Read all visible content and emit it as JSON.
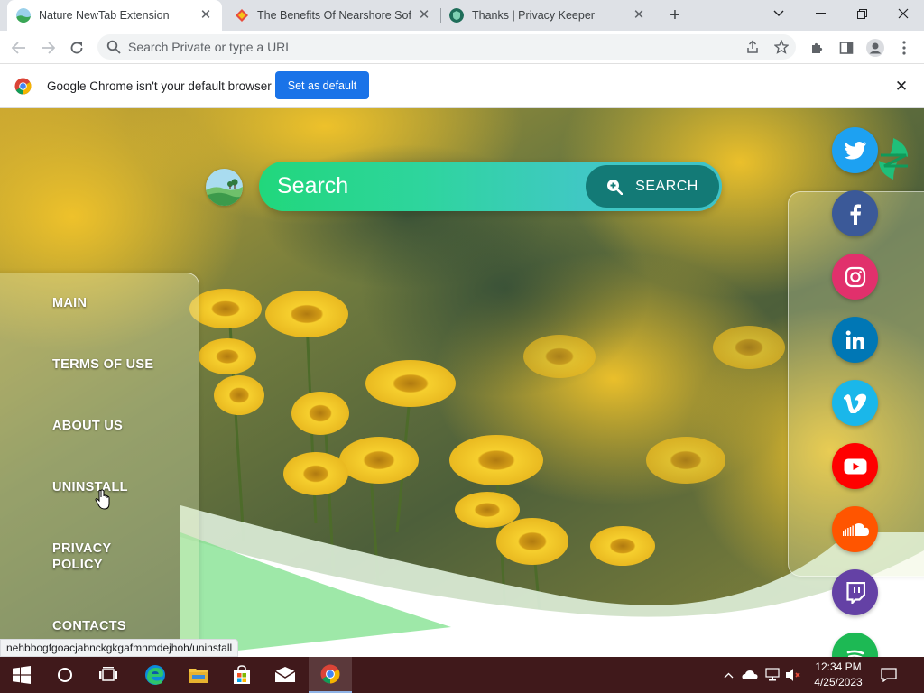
{
  "browser": {
    "tabs": [
      {
        "title": "Nature NewTab Extension",
        "active": true
      },
      {
        "title": "The Benefits Of Nearshore Softw",
        "active": false
      },
      {
        "title": "Thanks | Privacy Keeper",
        "active": false
      }
    ],
    "new_tab_icon": "plus-icon",
    "omnibox": {
      "placeholder": "Search Private or type a URL",
      "value": ""
    }
  },
  "infobar": {
    "message": "Google Chrome isn't your default browser",
    "button_label": "Set as default"
  },
  "page": {
    "search": {
      "placeholder": "Search",
      "button_label": "SEARCH"
    },
    "menu": [
      {
        "label": "MAIN"
      },
      {
        "label": "TERMS OF USE"
      },
      {
        "label": "ABOUT US"
      },
      {
        "label": "UNINSTALL"
      },
      {
        "label": "PRIVACY POLICY"
      },
      {
        "label": "CONTACTS"
      }
    ],
    "social": [
      {
        "name": "twitter",
        "icon": "twitter-icon",
        "color": "#1da1f2"
      },
      {
        "name": "facebook",
        "icon": "facebook-icon",
        "color": "#3b5998"
      },
      {
        "name": "instagram",
        "icon": "instagram-icon",
        "color": "#e1306c"
      },
      {
        "name": "linkedin",
        "icon": "linkedin-icon",
        "color": "#0077b5"
      },
      {
        "name": "vimeo",
        "icon": "vimeo-icon",
        "color": "#1ab7ea"
      },
      {
        "name": "youtube",
        "icon": "youtube-icon",
        "color": "#ff0000"
      },
      {
        "name": "soundcloud",
        "icon": "soundcloud-icon",
        "color": "#ff5500"
      },
      {
        "name": "twitch",
        "icon": "twitch-icon",
        "color": "#6441a5"
      },
      {
        "name": "spotify",
        "icon": "spotify-icon",
        "color": "#1db954"
      }
    ],
    "status_url": "nehbbogfgoacjabnckgkgafmnmdejhoh/uninstall"
  },
  "taskbar": {
    "time": "12:34 PM",
    "date": "4/25/2023"
  },
  "colors": {
    "search_gradient_start": "#21d77c",
    "search_button": "#137a76",
    "chrome_blue": "#1a73e8",
    "taskbar": "#40191b"
  }
}
